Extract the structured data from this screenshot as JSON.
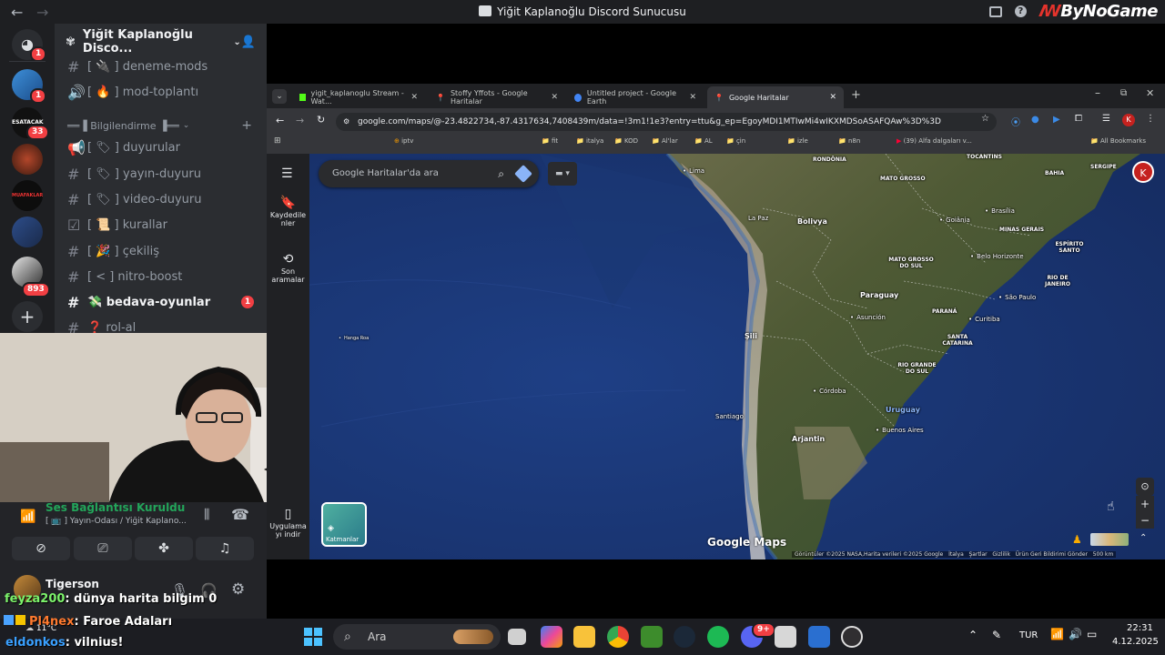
{
  "discord": {
    "window_title": "Yiğit Kaplanoğlu Discord Sunucusu",
    "brand": "ByNoGame",
    "server_name": "Yiğit Kaplanoğlu Disco...",
    "rail_badges": [
      "1",
      "1",
      "33",
      "893"
    ],
    "rail_labels": [
      "ESATACAK",
      "MUAFAKLAR"
    ],
    "category": "══▐ Bilgilendirme ▐══",
    "channels": [
      {
        "name": "[ 🔌 ] deneme-mods",
        "icon": "#"
      },
      {
        "name": "[ 🔥 ] mod-toplantı",
        "icon": "🔊"
      },
      {
        "name": "[ 🏷 ] duyurular",
        "icon": "📢"
      },
      {
        "name": "[ 🏷 ] yayın-duyuru",
        "icon": "#"
      },
      {
        "name": "[ 🏷 ] video-duyuru",
        "icon": "#"
      },
      {
        "name": "[ 📜 ] kurallar",
        "icon": "☑"
      },
      {
        "name": "[ 🎉 ] çekiliş",
        "icon": "#"
      },
      {
        "name": "[ < ] nitro-boost",
        "icon": "#"
      },
      {
        "name": "💸 bedava-oyunlar",
        "icon": "#",
        "active": true,
        "unread": "1"
      },
      {
        "name": "❓ rol-al",
        "icon": "#"
      }
    ],
    "voice": {
      "status": "Ses Bağlantısı Kuruldu",
      "channel": "[ 📺 ] Yayın-Odası / Yiğit Kaplano...",
      "user": "Tigerson"
    }
  },
  "chat_overlay": [
    {
      "user": "feyza200",
      "text": ": dünya harita bilgim 0",
      "color": "#7cf26b"
    },
    {
      "user": "Pl4nex",
      "text": ": Faroe Adaları",
      "color": "#ff7a2f"
    },
    {
      "user": "eldonkos",
      "text": ": vilnius!",
      "color": "#3aa0ff"
    }
  ],
  "chrome": {
    "tabs": [
      {
        "label": "yigit_kaplanoglu Stream - Wat...",
        "color": "#53fc18"
      },
      {
        "label": "Stoffy Yffots - Google Haritalar",
        "color": "#34a853"
      },
      {
        "label": "Untitled project - Google Earth",
        "color": "#4285f4"
      },
      {
        "label": "Google Haritalar",
        "color": "#34a853",
        "active": true
      }
    ],
    "url": "google.com/maps/@-23.4822734,-87.4317634,7408439m/data=!3m1!1e3?entry=ttu&g_ep=EgoyMDI1MTIwMi4wIKXMDSoASAFQAw%3D%3D",
    "bookmarks": [
      "iptv",
      "fit",
      "italya",
      "KOD",
      "Al'lar",
      "AL",
      "çin",
      "izle",
      "n8n",
      "(39) Alfa dalgaları v..."
    ],
    "all_bookmarks": "All Bookmarks",
    "profile_initial": "K"
  },
  "maps": {
    "search_placeholder": "Google Haritalar'da ara",
    "side": {
      "saved": "Kaydedile nler",
      "recent": "Son aramalar",
      "app": "Uygulama yı indir",
      "layers": "Katmanlar"
    },
    "logo": "Google Maps",
    "footer": "Görüntüler ©2025 NASA,Harita verileri ©2025 Google   İtalya   Şartlar   Gizlilik   Ürün Geri Bildirimi Gönder   500 km",
    "labels": {
      "countries": [
        "Bolivya",
        "Paraguay",
        "Şili",
        "Arjantin",
        "Uruguay"
      ],
      "cities": [
        "Lima",
        "La Paz",
        "Asunción",
        "Córdoba",
        "Santiago",
        "Buenos Aires",
        "São Paulo",
        "Curitiba",
        "Belo Horizonte",
        "Brasília",
        "Goiânia",
        "Hanga Roa"
      ],
      "states": [
        "RONDÔNIA",
        "MATO GROSSO",
        "MATO GROSSO DO SUL",
        "MINAS GERAIS",
        "ESPÍRITO SANTO",
        "RIO DE JANEIRO",
        "PARANÁ",
        "SANTA CATARINA",
        "RIO GRANDE DO SUL",
        "TOCANTINS",
        "BAHIA",
        "SERGIPE"
      ]
    },
    "avatar": "K"
  },
  "taskbar": {
    "search": "Ara",
    "weather_temp": "11°C",
    "language": "TUR",
    "time": "22:31",
    "date": "4.12.2025",
    "discord_badge": "9+"
  }
}
